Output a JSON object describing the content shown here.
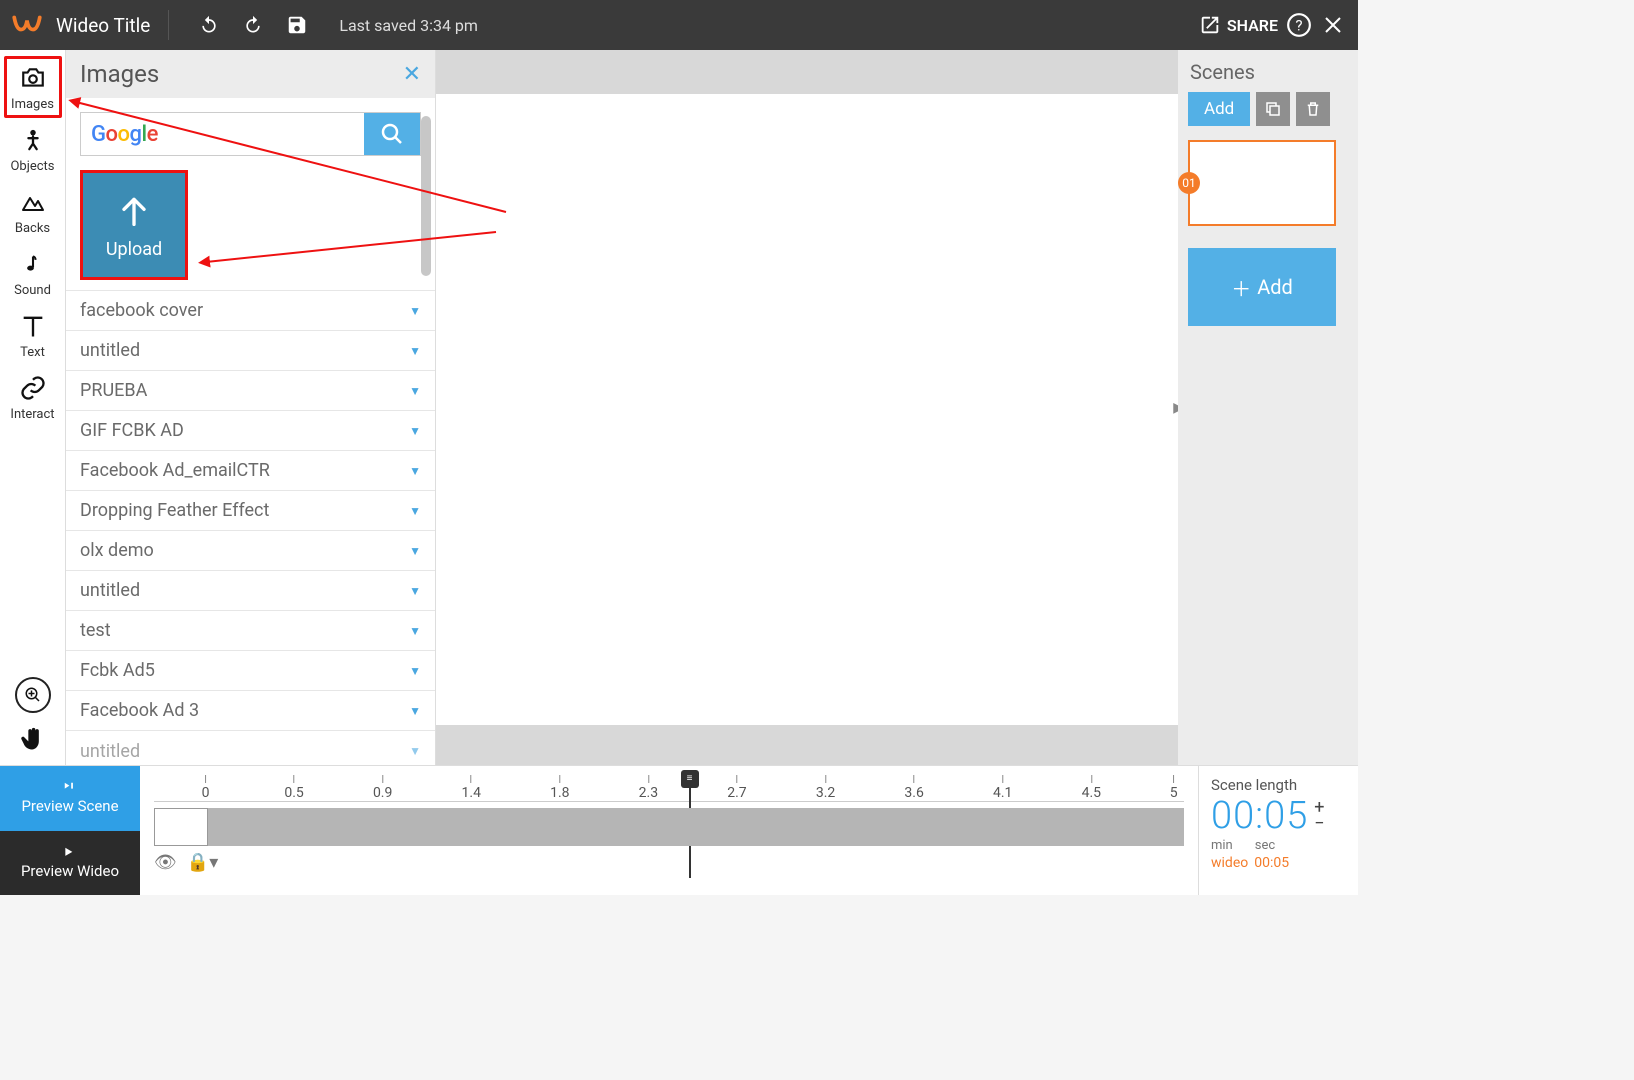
{
  "header": {
    "title": "Wideo Title",
    "last_saved": "Last saved 3:34 pm",
    "share": "SHARE"
  },
  "rail": {
    "images": "Images",
    "objects": "Objects",
    "backs": "Backs",
    "sound": "Sound",
    "text": "Text",
    "interact": "Interact"
  },
  "panel": {
    "title": "Images",
    "search_placeholder": "Google",
    "upload": "Upload",
    "folders": [
      "facebook cover",
      "untitled",
      "PRUEBA",
      "GIF FCBK AD",
      "Facebook Ad_emailCTR",
      "Dropping Feather Effect",
      "olx demo",
      "untitled",
      "test",
      "Fcbk Ad5",
      "Facebook Ad 3",
      "untitled"
    ]
  },
  "scenes": {
    "title": "Scenes",
    "add_small": "Add",
    "add_big": "Add",
    "badge": "01"
  },
  "preview": {
    "scene": "Preview Scene",
    "wideo": "Preview Wideo"
  },
  "ruler": [
    "0",
    "0.5",
    "0.9",
    "1.4",
    "1.8",
    "2.3",
    "2.7",
    "3.2",
    "3.6",
    "4.1",
    "4.5",
    "5"
  ],
  "length": {
    "title": "Scene length",
    "time": "00:05",
    "min": "min",
    "sec": "sec",
    "wideo_label": "wideo",
    "wideo_time": "00:05"
  }
}
